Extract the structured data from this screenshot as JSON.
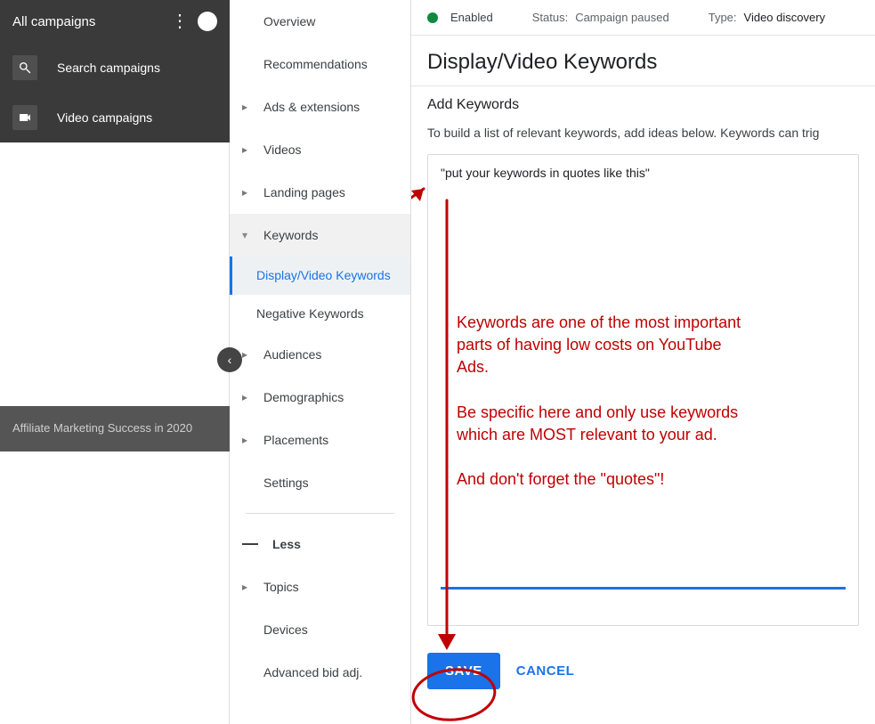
{
  "sidebar1": {
    "header": "All campaigns",
    "items": [
      {
        "label": "Search campaigns",
        "icon": "search"
      },
      {
        "label": "Video campaigns",
        "icon": "video"
      }
    ],
    "campaign_card": "Affiliate Marketing Success in 2020"
  },
  "sidebar2": {
    "items": [
      {
        "label": "Overview",
        "chev": false
      },
      {
        "label": "Recommendations",
        "chev": false
      },
      {
        "label": "Ads & extensions",
        "chev": true
      },
      {
        "label": "Videos",
        "chev": true
      },
      {
        "label": "Landing pages",
        "chev": true
      },
      {
        "label": "Keywords",
        "chev": true,
        "expanded": true,
        "subs": [
          {
            "label": "Display/Video Keywords",
            "active": true
          },
          {
            "label": "Negative Keywords",
            "active": false
          }
        ]
      },
      {
        "label": "Audiences",
        "chev": true
      },
      {
        "label": "Demographics",
        "chev": true
      },
      {
        "label": "Placements",
        "chev": true
      },
      {
        "label": "Settings",
        "chev": false
      }
    ],
    "less_label": "Less",
    "more_items": [
      {
        "label": "Topics",
        "chev": true
      },
      {
        "label": "Devices",
        "chev": false
      },
      {
        "label": "Advanced bid adj.",
        "chev": false
      }
    ]
  },
  "status": {
    "enabled_label": "Enabled",
    "status_label": "Status:",
    "status_value": "Campaign paused",
    "type_label": "Type:",
    "type_value": "Video discovery"
  },
  "main": {
    "title": "Display/Video Keywords",
    "add_heading": "Add Keywords",
    "description": "To build a list of relevant keywords, add ideas below. Keywords can trig",
    "input_value": "\"put your keywords in quotes like this\"",
    "save_label": "SAVE",
    "cancel_label": "CANCEL"
  },
  "annotation": {
    "text": "Keywords are one of the most important parts of having low costs on YouTube Ads.\n\nBe specific here and only use keywords which are MOST relevant to your ad.\n\nAnd don't forget the \"quotes\"!",
    "color": "#c00000"
  }
}
